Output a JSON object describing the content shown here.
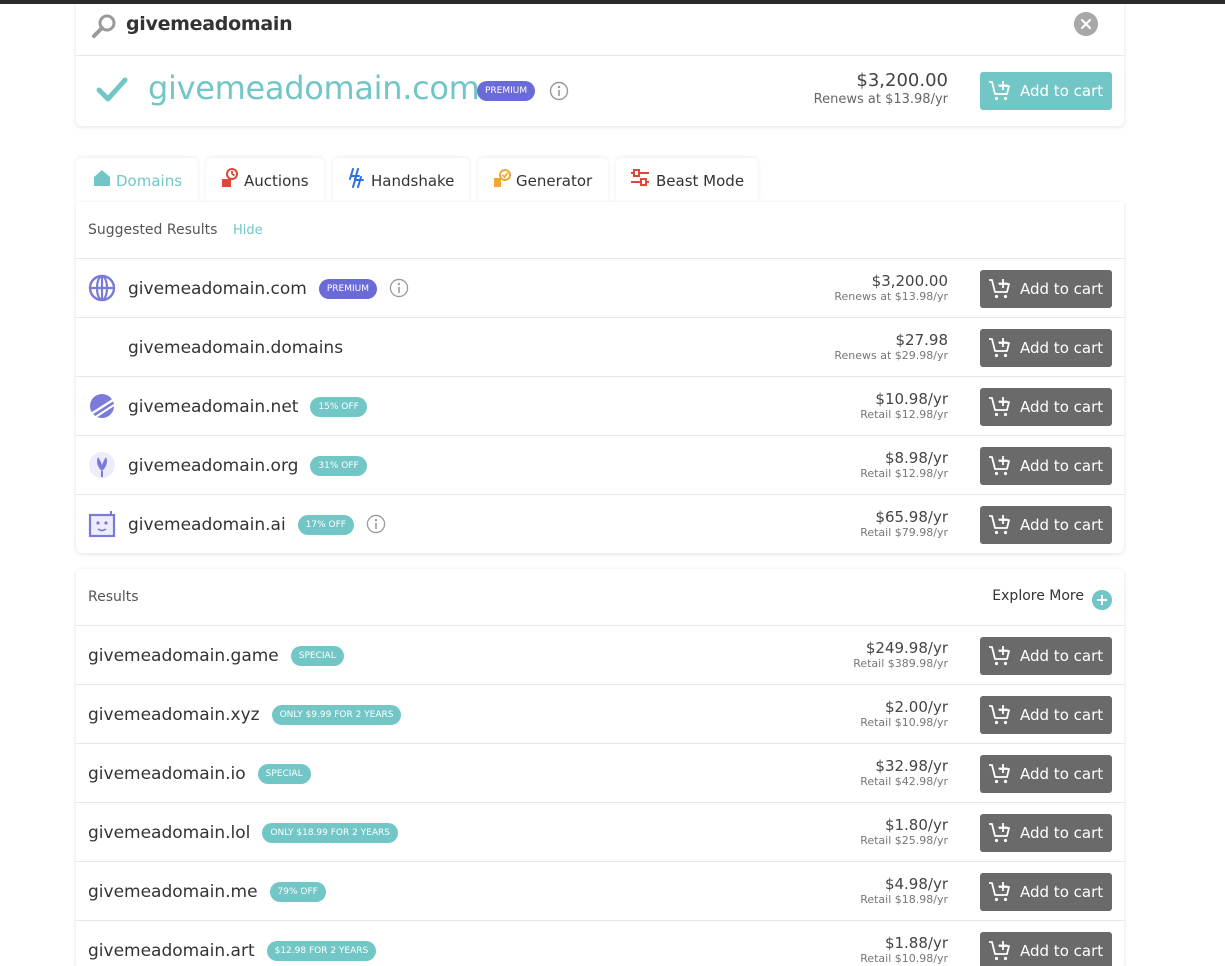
{
  "search": {
    "query": "givemeadomain"
  },
  "hero": {
    "domain": "givemeadomain.com",
    "badge": "PREMIUM",
    "price": "$3,200.00",
    "renewal": "Renews at $13.98/yr",
    "cart_label": "Add to cart"
  },
  "tabs": [
    {
      "label": "Domains",
      "icon": "house-icon",
      "active": true
    },
    {
      "label": "Auctions",
      "icon": "gavel-icon",
      "active": false
    },
    {
      "label": "Handshake",
      "icon": "handshake-icon",
      "active": false
    },
    {
      "label": "Generator",
      "icon": "generator-icon",
      "active": false
    },
    {
      "label": "Beast Mode",
      "icon": "sliders-icon",
      "active": false
    }
  ],
  "suggested": {
    "title": "Suggested Results",
    "hide_label": "Hide",
    "rows": [
      {
        "domain": "givemeadomain.com",
        "badge": "PREMIUM",
        "badge_style": "premium",
        "info": true,
        "price": "$3,200.00",
        "sub": "Renews at $13.98/yr",
        "logo": "globe-icon"
      },
      {
        "domain": "givemeadomain.domains",
        "badge": "",
        "badge_style": "",
        "info": false,
        "price": "$27.98",
        "sub": "Renews at $29.98/yr",
        "logo": ""
      },
      {
        "domain": "givemeadomain.net",
        "badge": "15% OFF",
        "badge_style": "teal",
        "info": false,
        "price": "$10.98/yr",
        "sub": "Retail $12.98/yr",
        "logo": "planet-icon"
      },
      {
        "domain": "givemeadomain.org",
        "badge": "31% OFF",
        "badge_style": "teal",
        "info": false,
        "price": "$8.98/yr",
        "sub": "Retail $12.98/yr",
        "logo": "lotus-icon"
      },
      {
        "domain": "givemeadomain.ai",
        "badge": "17% OFF",
        "badge_style": "teal",
        "info": true,
        "price": "$65.98/yr",
        "sub": "Retail $79.98/yr",
        "logo": "robot-icon"
      }
    ]
  },
  "results": {
    "title": "Results",
    "explore_label": "Explore More",
    "rows": [
      {
        "domain": "givemeadomain.game",
        "badge": "SPECIAL",
        "price": "$249.98/yr",
        "sub": "Retail $389.98/yr"
      },
      {
        "domain": "givemeadomain.xyz",
        "badge": "ONLY $9.99 FOR 2 YEARS",
        "price": "$2.00/yr",
        "sub": "Retail $10.98/yr"
      },
      {
        "domain": "givemeadomain.io",
        "badge": "SPECIAL",
        "price": "$32.98/yr",
        "sub": "Retail $42.98/yr"
      },
      {
        "domain": "givemeadomain.lol",
        "badge": "ONLY $18.99 FOR 2 YEARS",
        "price": "$1.80/yr",
        "sub": "Retail $25.98/yr"
      },
      {
        "domain": "givemeadomain.me",
        "badge": "79% OFF",
        "price": "$4.98/yr",
        "sub": "Retail $18.98/yr"
      },
      {
        "domain": "givemeadomain.art",
        "badge": "$12.98 FOR 2 YEARS",
        "price": "$1.88/yr",
        "sub": "Retail $10.98/yr"
      }
    ]
  },
  "cart_label": "Add to cart",
  "colors": {
    "teal": "#72c7c6",
    "premium": "#6b6bd8",
    "cart_button": "#6a6a6a",
    "auctions_red": "#e0463a",
    "handshake_blue": "#2b6fe0",
    "generator_orange": "#f0a830",
    "beast_red": "#e0463a"
  }
}
